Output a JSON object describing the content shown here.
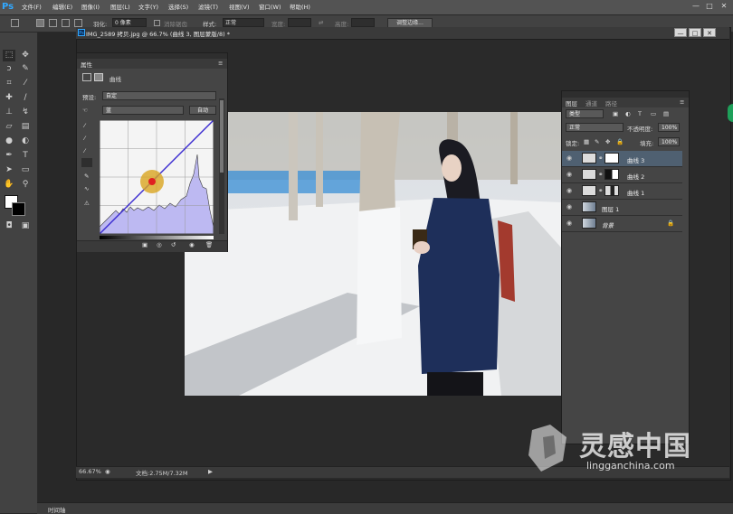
{
  "app": {
    "logo": "Ps"
  },
  "menu": [
    "文件(F)",
    "编辑(E)",
    "图像(I)",
    "图层(L)",
    "文字(Y)",
    "选择(S)",
    "滤镜(T)",
    "视图(V)",
    "窗口(W)",
    "帮助(H)"
  ],
  "window_controls": {
    "minimize": "—",
    "restore": "□",
    "close": "✕"
  },
  "options_bar": {
    "feather_label": "羽化:",
    "feather_value": "0 像素",
    "antialias_label": "消除锯齿",
    "style_label": "样式:",
    "style_value": "正常",
    "width_label": "宽度:",
    "height_label": "高度:",
    "refine_button": "调整边缘..."
  },
  "document": {
    "tab_title": "IMG_2589 拷贝.jpg @ 66.7% (曲线 3, 图层蒙版/8) *",
    "zoom": "66.67%",
    "doc_info": "文档:2.75M/7.32M"
  },
  "properties": {
    "tab": "属性",
    "title": "曲线",
    "preset_label": "预设:",
    "preset_value": "自定",
    "channel_value": "蓝",
    "auto_button": "自动"
  },
  "layers_panel": {
    "tabs": [
      "图层",
      "通道",
      "路径"
    ],
    "filter_value": "类型",
    "blend_mode": "正常",
    "opacity_label": "不透明度:",
    "opacity_value": "100%",
    "lock_label": "锁定:",
    "fill_label": "填充:",
    "fill_value": "100%",
    "layers": [
      {
        "name": "曲线 3",
        "selected": true
      },
      {
        "name": "曲线 2",
        "selected": false
      },
      {
        "name": "曲线 1",
        "selected": false
      },
      {
        "name": "图层 1",
        "selected": false
      },
      {
        "name": "背景",
        "selected": false
      }
    ]
  },
  "bottom": {
    "timeline_label": "时间轴"
  },
  "watermark": {
    "cn": "灵感中国",
    "en": "lingganchina.com"
  },
  "colors": {
    "accent": "#31a8ff",
    "selected_layer": "#4f6071",
    "curve": "#3a2bd0"
  }
}
